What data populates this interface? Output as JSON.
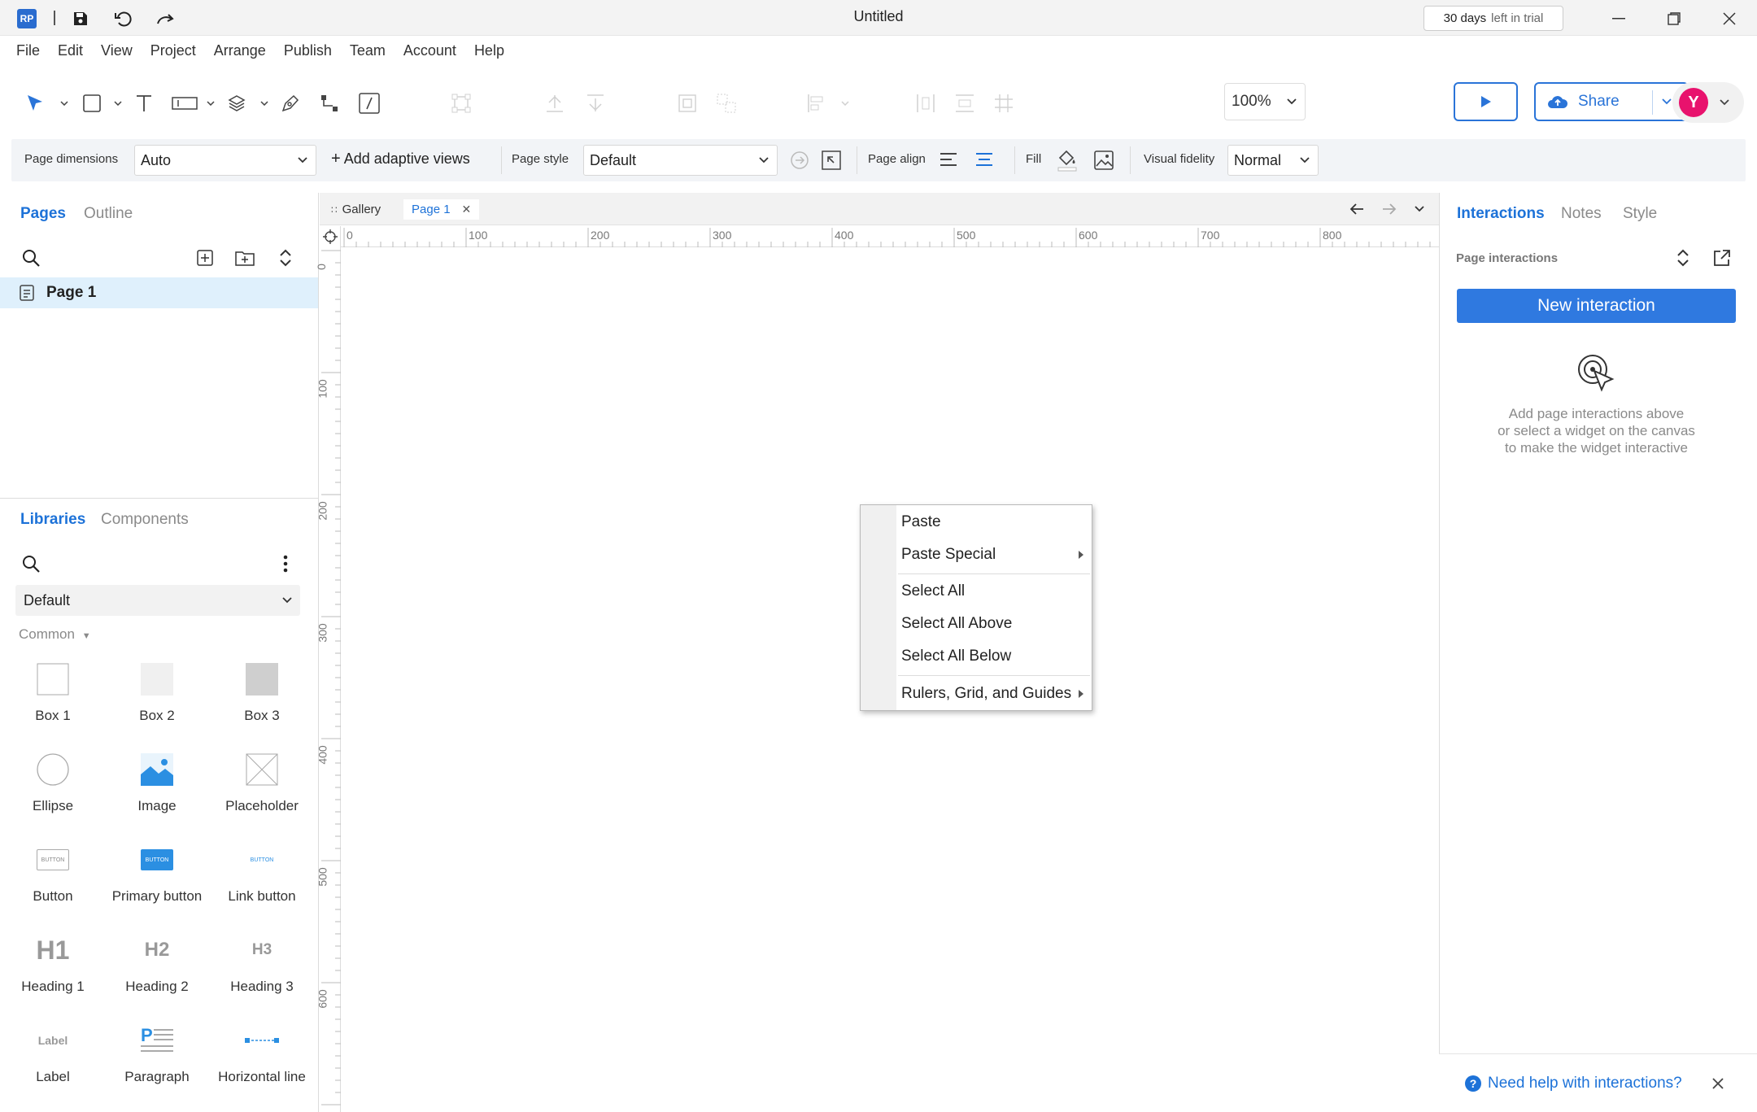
{
  "window": {
    "app_logo": "RP",
    "title": "Untitled",
    "trial_days": "30 days",
    "trial_suffix": "left in trial"
  },
  "menu": [
    "File",
    "Edit",
    "View",
    "Project",
    "Arrange",
    "Publish",
    "Team",
    "Account",
    "Help"
  ],
  "toolbar": {
    "zoom": "100%",
    "share_label": "Share",
    "avatar_initial": "Y"
  },
  "page_props": {
    "dimensions_label": "Page dimensions",
    "dimensions_value": "Auto",
    "adaptive_label": "Add adaptive views",
    "style_label": "Page style",
    "style_value": "Default",
    "align_label": "Page align",
    "fill_label": "Fill",
    "fidelity_label": "Visual fidelity",
    "fidelity_value": "Normal"
  },
  "left": {
    "tabs": [
      "Pages",
      "Outline"
    ],
    "pages": [
      {
        "label": "Page 1"
      }
    ],
    "lib_tabs": [
      "Libraries",
      "Components"
    ],
    "library": "Default",
    "section": "Common",
    "widgets": [
      {
        "label": "Box 1",
        "icon": "box1-icon"
      },
      {
        "label": "Box 2",
        "icon": "box2-icon"
      },
      {
        "label": "Box 3",
        "icon": "box3-icon"
      },
      {
        "label": "Ellipse",
        "icon": "ellipse-icon"
      },
      {
        "label": "Image",
        "icon": "image-icon"
      },
      {
        "label": "Placeholder",
        "icon": "placeholder-icon"
      },
      {
        "label": "Button",
        "icon": "button-icon",
        "thumb_text": "BUTTON"
      },
      {
        "label": "Primary button",
        "icon": "primary-button-icon",
        "thumb_text": "BUTTON"
      },
      {
        "label": "Link button",
        "icon": "link-button-icon",
        "thumb_text": "BUTTON"
      },
      {
        "label": "Heading 1",
        "icon": "heading1-icon",
        "thumb_text": "H1"
      },
      {
        "label": "Heading 2",
        "icon": "heading2-icon",
        "thumb_text": "H2"
      },
      {
        "label": "Heading 3",
        "icon": "heading3-icon",
        "thumb_text": "H3"
      },
      {
        "label": "Label",
        "icon": "label-icon",
        "thumb_text": "Label"
      },
      {
        "label": "Paragraph",
        "icon": "paragraph-icon"
      },
      {
        "label": "Horizontal line",
        "icon": "horizontal-line-icon"
      }
    ]
  },
  "canvas": {
    "tabs": [
      "Gallery",
      "Page 1"
    ],
    "ruler_h": [
      "0",
      "100",
      "200",
      "300",
      "400",
      "500",
      "600",
      "700",
      "800"
    ],
    "ruler_v": [
      "0",
      "100",
      "200",
      "300",
      "400",
      "500",
      "600"
    ]
  },
  "context_menu": {
    "items": [
      {
        "label": "Paste",
        "submenu": false
      },
      {
        "label": "Paste Special",
        "submenu": true
      },
      {
        "label": "Select All",
        "submenu": false
      },
      {
        "label": "Select All Above",
        "submenu": false
      },
      {
        "label": "Select All Below",
        "submenu": false
      },
      {
        "label": "Rulers, Grid, and Guides",
        "submenu": true
      }
    ]
  },
  "right": {
    "tabs": [
      "Interactions",
      "Notes",
      "Style"
    ],
    "page_interactions_label": "Page interactions",
    "new_interaction": "New interaction",
    "hint_lines": [
      "Add page interactions above",
      "or select a widget on the canvas",
      "to make the widget interactive"
    ],
    "help_link": "Need help with interactions?"
  },
  "colors": {
    "accent": "#1d72d8",
    "primary_button": "#2f79e0",
    "avatar": "#e8126d",
    "selected_row": "#dff0fc"
  }
}
